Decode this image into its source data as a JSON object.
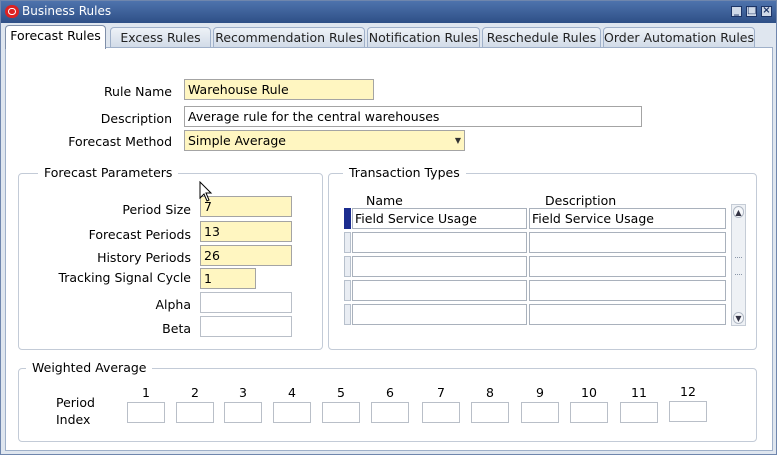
{
  "window": {
    "title": "Business Rules"
  },
  "tabs": [
    {
      "label": "Forecast Rules"
    },
    {
      "label": "Excess Rules"
    },
    {
      "label": "Recommendation Rules"
    },
    {
      "label": "Notification Rules"
    },
    {
      "label": "Reschedule Rules"
    },
    {
      "label": "Order Automation Rules"
    }
  ],
  "form": {
    "rule_name_label": "Rule Name",
    "rule_name_value": "Warehouse Rule",
    "description_label": "Description",
    "description_value": "Average rule for the central warehouses",
    "forecast_method_label": "Forecast Method",
    "forecast_method_value": "Simple Average"
  },
  "forecast_parameters": {
    "title": "Forecast Parameters",
    "period_size_label": "Period Size",
    "period_size_value": "7",
    "forecast_periods_label": "Forecast Periods",
    "forecast_periods_value": "13",
    "history_periods_label": "History Periods",
    "history_periods_value": "26",
    "tracking_signal_label": "Tracking Signal Cycle",
    "tracking_signal_value": "1",
    "alpha_label": "Alpha",
    "alpha_value": "",
    "beta_label": "Beta",
    "beta_value": ""
  },
  "transaction_types": {
    "title": "Transaction Types",
    "col_name": "Name",
    "col_description": "Description",
    "rows": [
      {
        "name": "Field Service Usage",
        "description": "Field Service Usage"
      },
      {
        "name": "",
        "description": ""
      },
      {
        "name": "",
        "description": ""
      },
      {
        "name": "",
        "description": ""
      },
      {
        "name": "",
        "description": ""
      }
    ]
  },
  "weighted_average": {
    "title": "Weighted Average",
    "period_label": "Period",
    "index_label": "Index",
    "periods": [
      "1",
      "2",
      "3",
      "4",
      "5",
      "6",
      "7",
      "8",
      "9",
      "10",
      "11",
      "12"
    ]
  }
}
